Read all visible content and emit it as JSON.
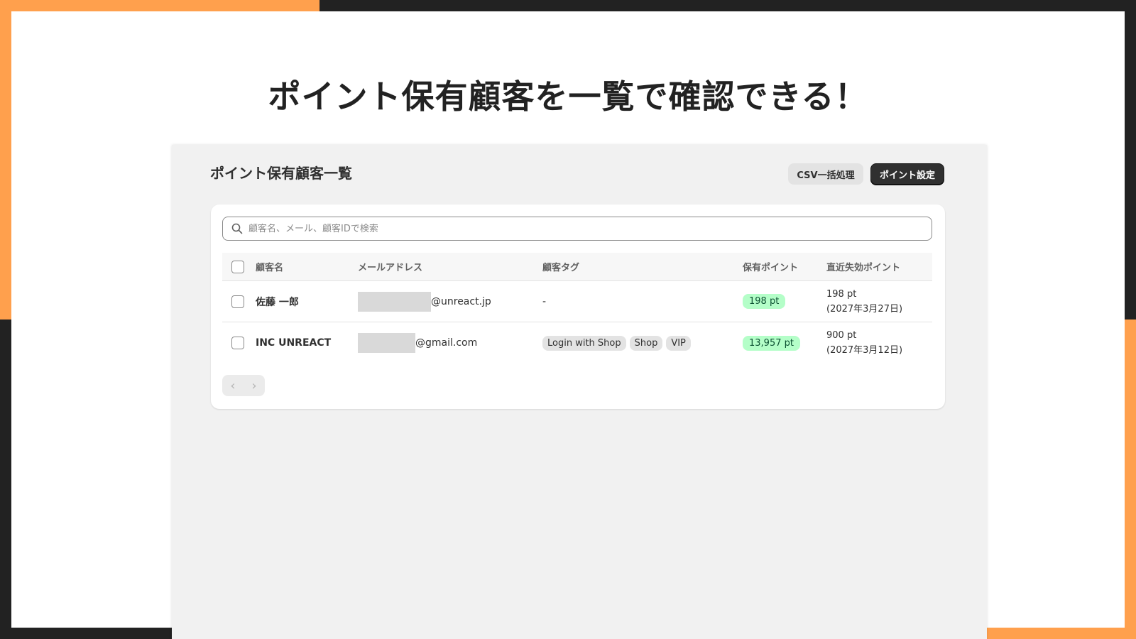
{
  "headline": "ポイント保有顧客を一覧で確認できる！",
  "app": {
    "page_title": "ポイント保有顧客一覧",
    "buttons": {
      "csv": "CSV一括処理",
      "settings": "ポイント設定"
    },
    "search": {
      "placeholder": "顧客名、メール、顧客IDで検索",
      "icon": "search-icon"
    },
    "table": {
      "headers": [
        "顧客名",
        "メールアドレス",
        "顧客タグ",
        "保有ポイント",
        "直近失効ポイント"
      ],
      "rows": [
        {
          "name": "佐藤 一郎",
          "email_domain": "@unreact.jp",
          "tags": "-",
          "points": "198 pt",
          "expire_points": "198 pt",
          "expire_date": "(2027年3月27日)"
        },
        {
          "name": "INC UNREACT",
          "email_domain": "@gmail.com",
          "tags": [
            "Login with Shop",
            "Shop",
            "VIP"
          ],
          "points": "13,957 pt",
          "expire_points": "900 pt",
          "expire_date": "(2027年3月12日)"
        }
      ]
    },
    "pagination": {
      "prev_icon": "chevron-left-icon",
      "next_icon": "chevron-right-icon"
    }
  },
  "colors": {
    "frame_dark": "#222222",
    "frame_orange": "#FFA04D",
    "primary_button": "#303030",
    "points_badge": "#B4FEC8"
  }
}
